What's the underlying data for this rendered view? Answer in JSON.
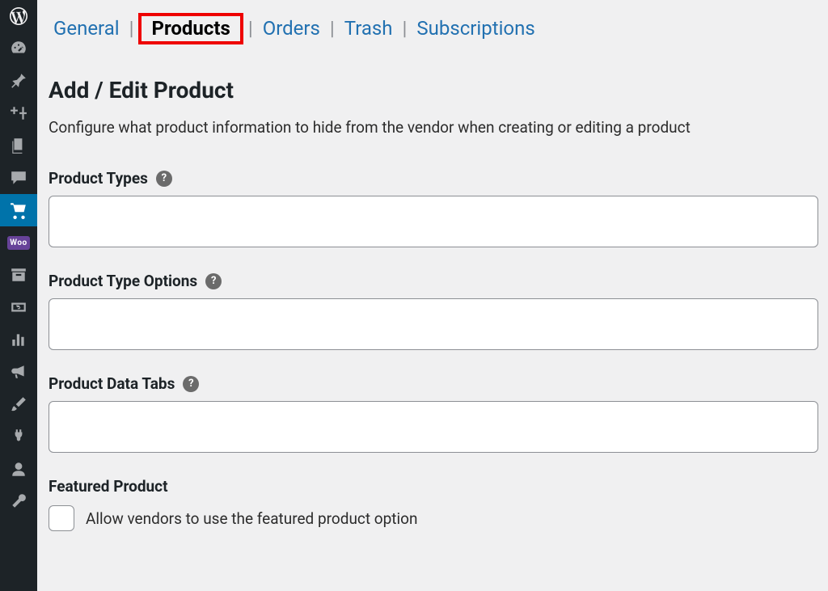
{
  "tabs": {
    "general": "General",
    "products": "Products",
    "orders": "Orders",
    "trash": "Trash",
    "subscriptions": "Subscriptions"
  },
  "page": {
    "title": "Add / Edit Product",
    "description": "Configure what product information to hide from the vendor when creating or editing a product"
  },
  "fields": {
    "product_types": {
      "label": "Product Types"
    },
    "product_type_options": {
      "label": "Product Type Options"
    },
    "product_data_tabs": {
      "label": "Product Data Tabs"
    },
    "featured_product": {
      "label": "Featured Product",
      "option": "Allow vendors to use the featured product option"
    }
  },
  "sidebar": {
    "woo_badge": "Woo"
  }
}
